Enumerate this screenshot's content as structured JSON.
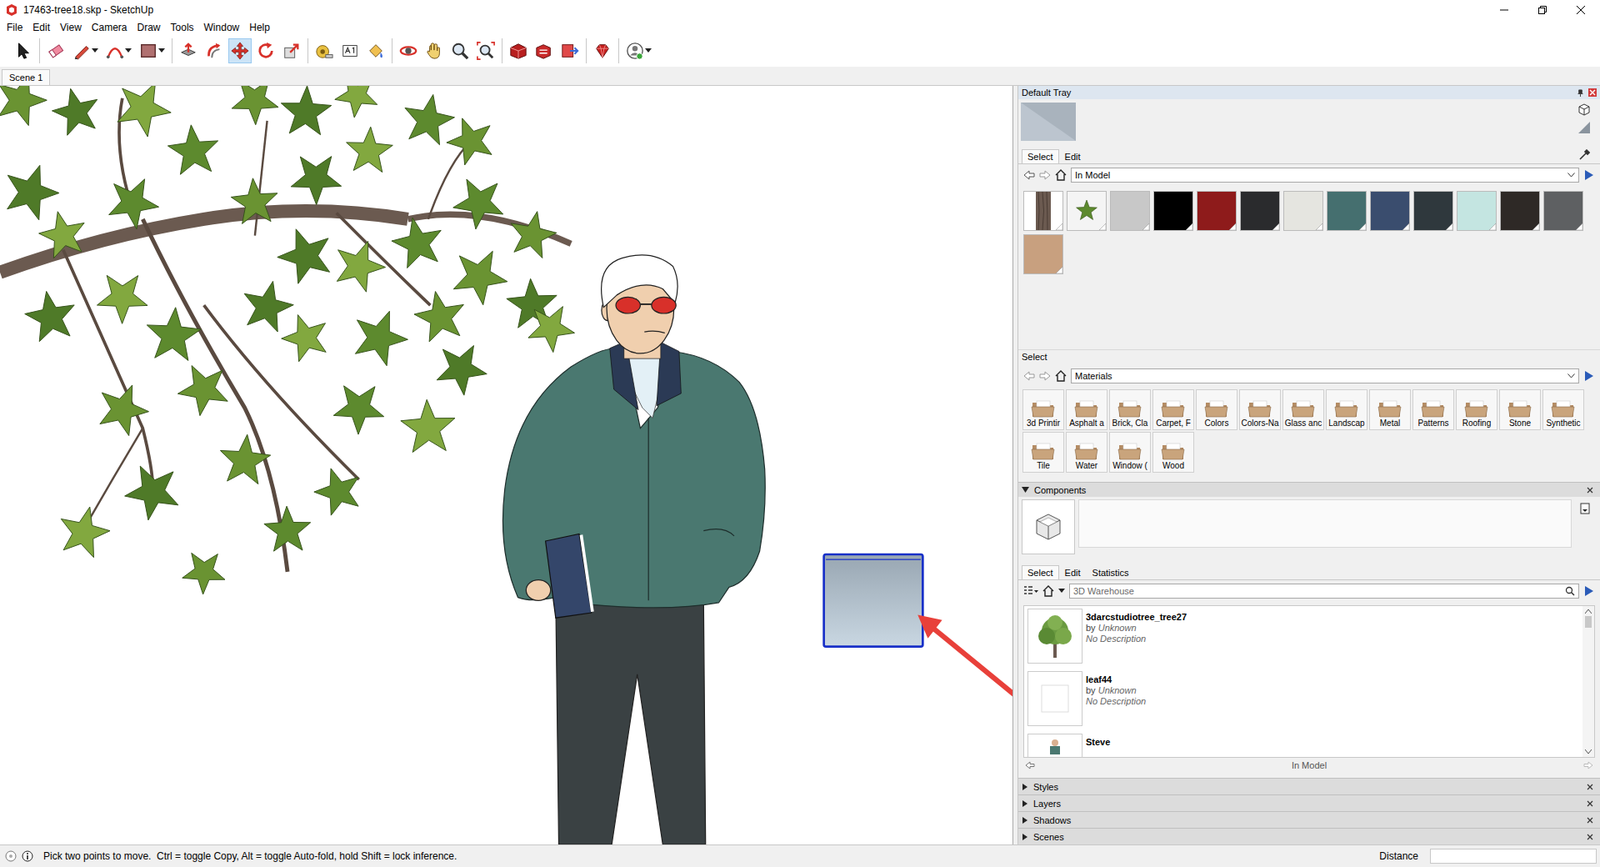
{
  "window": {
    "title": "17463-tree18.skp - SketchUp"
  },
  "menu": [
    "File",
    "Edit",
    "View",
    "Camera",
    "Draw",
    "Tools",
    "Window",
    "Help"
  ],
  "toolbar": [
    [
      {
        "kind": "select",
        "selected": false,
        "dropdown": false
      }
    ],
    [
      {
        "kind": "eraser",
        "selected": false,
        "dropdown": false
      },
      {
        "kind": "line",
        "selected": false,
        "dropdown": true
      },
      {
        "kind": "arc",
        "selected": false,
        "dropdown": true
      },
      {
        "kind": "shape",
        "selected": false,
        "dropdown": true
      }
    ],
    [
      {
        "kind": "push-pull",
        "selected": false,
        "dropdown": false
      },
      {
        "kind": "offset",
        "selected": false,
        "dropdown": false
      },
      {
        "kind": "move",
        "selected": true,
        "dropdown": false
      },
      {
        "kind": "rotate",
        "selected": false,
        "dropdown": false
      },
      {
        "kind": "scale",
        "selected": false,
        "dropdown": false
      }
    ],
    [
      {
        "kind": "tape",
        "selected": false,
        "dropdown": false
      },
      {
        "kind": "text",
        "selected": false,
        "dropdown": false
      },
      {
        "kind": "paint",
        "selected": false,
        "dropdown": false
      }
    ],
    [
      {
        "kind": "orbit",
        "selected": false,
        "dropdown": false
      },
      {
        "kind": "pan",
        "selected": false,
        "dropdown": false
      },
      {
        "kind": "zoom",
        "selected": false,
        "dropdown": false
      },
      {
        "kind": "zoom-extents",
        "selected": false,
        "dropdown": false
      }
    ],
    [
      {
        "kind": "warehouse",
        "selected": false,
        "dropdown": false
      },
      {
        "kind": "share",
        "selected": false,
        "dropdown": false
      },
      {
        "kind": "layout",
        "selected": false,
        "dropdown": false
      }
    ],
    [
      {
        "kind": "extensions",
        "selected": false,
        "dropdown": false
      }
    ],
    [
      {
        "kind": "account",
        "selected": false,
        "dropdown": true
      }
    ]
  ],
  "scene_tabs": [
    {
      "label": "Scene 1",
      "selected": true
    }
  ],
  "tray": {
    "title": "Default Tray",
    "materials": {
      "tabs": [
        {
          "label": "Select",
          "selected": true
        },
        {
          "label": "Edit",
          "selected": false
        }
      ],
      "collection": "In Model",
      "swatches": [
        {
          "kind": "wood",
          "color": "#7a6a5e",
          "marked": true
        },
        {
          "kind": "leaf",
          "color": "#f4f4f4",
          "marked": true
        },
        {
          "kind": "color",
          "color": "#c8c8c8",
          "marked": true
        },
        {
          "kind": "color",
          "color": "#000000",
          "marked": true
        },
        {
          "kind": "color",
          "color": "#8e1b1b",
          "marked": true
        },
        {
          "kind": "color",
          "color": "#2a2b2d",
          "marked": true
        },
        {
          "kind": "color",
          "color": "#e5e5e0",
          "marked": true
        },
        {
          "kind": "color",
          "color": "#456f6f",
          "marked": true
        },
        {
          "kind": "color",
          "color": "#3a4d6e",
          "marked": true
        },
        {
          "kind": "color",
          "color": "#2f383d",
          "marked": true
        },
        {
          "kind": "color",
          "color": "#c4e5e1",
          "marked": true
        },
        {
          "kind": "color",
          "color": "#2e2926",
          "marked": true
        },
        {
          "kind": "color",
          "color": "#5e6062",
          "marked": true
        },
        {
          "kind": "color",
          "color": "#c8a07f",
          "marked": true
        }
      ],
      "library_label": "Select",
      "library": "Materials",
      "folders": [
        "3d Printir",
        "Asphalt a",
        "Brick, Cla",
        "Carpet, F",
        "Colors",
        "Colors-Na",
        "Glass anc",
        "Landscap",
        "Metal",
        "Patterns",
        "Roofing",
        "Stone",
        "Synthetic",
        "Tile",
        "Water",
        "Window (",
        "Wood"
      ]
    },
    "components": {
      "title": "Components",
      "expanded": true,
      "tabs": [
        {
          "label": "Select",
          "selected": true
        },
        {
          "label": "Edit",
          "selected": false
        },
        {
          "label": "Statistics",
          "selected": false
        }
      ],
      "search_placeholder": "3D Warehouse",
      "items": [
        {
          "kind": "tree",
          "name": "3darcstudiotree_tree27",
          "by": "by",
          "author": "Unknown",
          "description": "No Description"
        },
        {
          "kind": "blank",
          "name": "leaf44",
          "by": "by",
          "author": "Unknown",
          "description": "No Description"
        },
        {
          "kind": "person",
          "name": "Steve",
          "by": "",
          "author": "",
          "description": ""
        }
      ],
      "footer": "In Model"
    },
    "panels": [
      {
        "label": "Styles",
        "expanded": false
      },
      {
        "label": "Layers",
        "expanded": false
      },
      {
        "label": "Shadows",
        "expanded": false
      },
      {
        "label": "Scenes",
        "expanded": false
      }
    ]
  },
  "status_bar": {
    "message": "Pick two points to move.  Ctrl = toggle Copy, Alt = toggle Auto-fold, hold Shift = lock inference.",
    "measure_label": "Distance",
    "measure_value": ""
  }
}
